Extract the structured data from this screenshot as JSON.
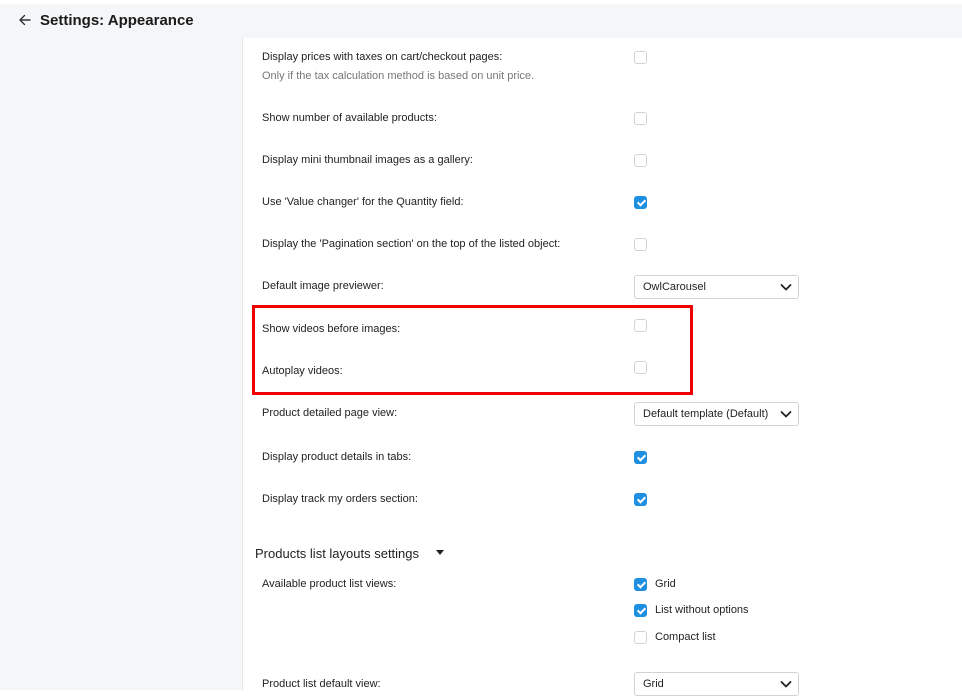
{
  "header": {
    "title": "Settings: Appearance"
  },
  "settings": [
    {
      "label": "Display prices with taxes on cart/checkout pages:",
      "hint": "Only if the tax calculation method is based on unit price.",
      "checked": false
    },
    {
      "label": "Show number of available products:",
      "checked": false
    },
    {
      "label": "Display mini thumbnail images as a gallery:",
      "checked": false
    },
    {
      "label": "Use 'Value changer' for the Quantity field:",
      "checked": true
    },
    {
      "label": "Display the 'Pagination section' on the top of the listed object:",
      "checked": false
    },
    {
      "label": "Default image previewer:",
      "value": "OwlCarousel"
    },
    {
      "label": "Show videos before images:",
      "checked": false
    },
    {
      "label": "Autoplay videos:",
      "checked": false
    },
    {
      "label": "Product detailed page view:",
      "value": "Default template (Default)"
    },
    {
      "label": "Display product details in tabs:",
      "checked": true
    },
    {
      "label": "Display track my orders section:",
      "checked": true
    }
  ],
  "products_list": {
    "section_title": "Products list layouts settings",
    "views_label": "Available product list views:",
    "views": [
      {
        "label": "Grid",
        "checked": true
      },
      {
        "label": "List without options",
        "checked": true
      },
      {
        "label": "Compact list",
        "checked": false
      }
    ],
    "default_view_label": "Product list default view:",
    "default_view_value": "Grid"
  },
  "colors": {
    "accent": "#1e8fe1",
    "highlight": "#ee0000"
  }
}
